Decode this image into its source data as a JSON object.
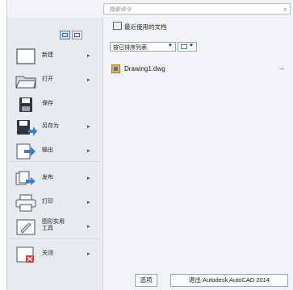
{
  "search": {
    "placeholder": "搜索命令"
  },
  "menu": [
    {
      "label": "新建",
      "icon": "new-file-icon",
      "has_arrow": true
    },
    {
      "label": "打开",
      "icon": "open-folder-icon",
      "has_arrow": true
    },
    {
      "label": "保存",
      "icon": "save-disk-icon",
      "has_arrow": false
    },
    {
      "label": "另存为",
      "icon": "save-as-icon",
      "has_arrow": true
    },
    {
      "label": "输出",
      "icon": "export-icon",
      "has_arrow": true
    },
    {
      "label": "发布",
      "icon": "publish-icon",
      "has_arrow": true
    },
    {
      "label": "打印",
      "icon": "printer-icon",
      "has_arrow": true
    },
    {
      "label": "图形实用\n工具",
      "icon": "drawing-utilities-icon",
      "has_arrow": true
    },
    {
      "label": "关闭",
      "icon": "close-file-icon",
      "has_arrow": true
    }
  ],
  "recent": {
    "title": "最近使用的文档",
    "sort_label": "按已排序列表",
    "documents": [
      {
        "name": "Drawing1.dwg"
      }
    ]
  },
  "footer": {
    "options_label": "选项",
    "exit_label": "退出 Autodesk AutoCAD 2014"
  },
  "colors": {
    "panel_bg": "#f1f3f6",
    "accent": "#3f7ec4"
  }
}
